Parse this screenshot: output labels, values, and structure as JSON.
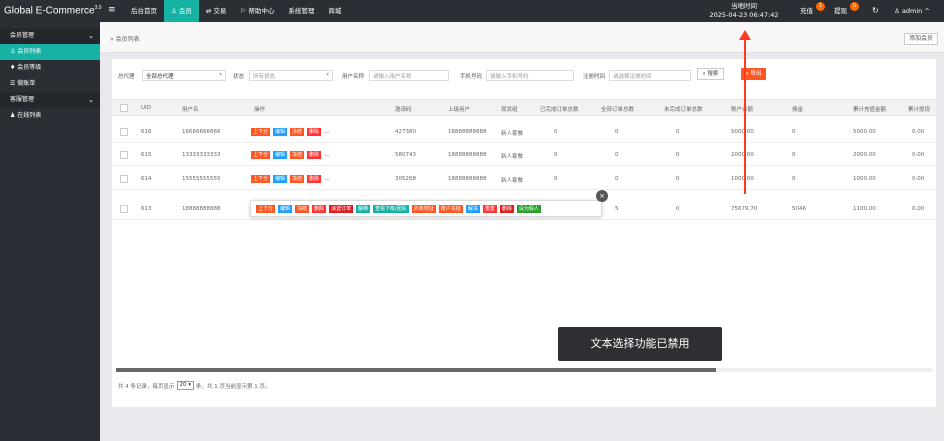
{
  "app": {
    "brand": "Global E-Commerce",
    "version": "3.0",
    "menu_toggle_icon": "≡"
  },
  "topnav": [
    {
      "label": "后台首页",
      "icon": "",
      "active": false
    },
    {
      "label": "会员",
      "icon": "person-icon",
      "active": true
    },
    {
      "label": "交易",
      "icon": "exchange-icon",
      "active": false
    },
    {
      "label": "帮助中心",
      "icon": "flag-icon",
      "active": false
    },
    {
      "label": "系统管理",
      "icon": "",
      "active": false
    },
    {
      "label": "商城",
      "icon": "",
      "active": false
    }
  ],
  "header_right": {
    "time_label": "当地时间",
    "time_value": "2025-04-23 06:47:42",
    "recharge_label": "充值",
    "recharge_count": "1",
    "withdraw_label": "提现",
    "withdraw_count": "0",
    "refresh_icon": "↻",
    "user_label": "admin"
  },
  "sidebar": {
    "groups": [
      {
        "label": "会员管理",
        "expanded": true
      },
      {
        "label": "会员列表",
        "active": true
      },
      {
        "label": "会员等级"
      },
      {
        "label": "做账单"
      },
      {
        "label": "客服管理",
        "expanded": true
      },
      {
        "label": "在线列表"
      }
    ]
  },
  "breadcrumb": {
    "separator": "»",
    "current": "会员列表",
    "add_member_label": "添加会员"
  },
  "filters": {
    "proxy_label": "总代理",
    "proxy_value": "全部总代理",
    "status_label": "状态",
    "status_value": "所有状态",
    "username_label": "用户名称",
    "username_placeholder": "请输入用户名称",
    "phone_label": "手机号码",
    "phone_placeholder": "请输入手机号码",
    "regtime_label": "注册时间",
    "regtime_placeholder": "请选择注册时间",
    "search_label": "搜索",
    "export_label": "导出"
  },
  "table": {
    "columns": [
      "UID",
      "用户名",
      "操作",
      "邀请码",
      "上级用户",
      "现状组",
      "已完成订单总数",
      "全部订单总数",
      "未完成订单总数",
      "账户余额",
      "佣金",
      "累计充值金额",
      "累计提现"
    ],
    "op_buttons": [
      {
        "label": "上下分",
        "color": "orange"
      },
      {
        "label": "编辑",
        "color": "blue"
      },
      {
        "label": "冻结",
        "color": "orange"
      },
      {
        "label": "删除",
        "color": "red"
      }
    ],
    "more": "...",
    "rows": [
      {
        "uid": "616",
        "username": "16666666666",
        "code": "427380",
        "parent": "18888888888",
        "group": "新人套餐",
        "done": "0",
        "all": "0",
        "pending": "0",
        "balance": "5000.00",
        "commission": "0",
        "recharge": "5000.00",
        "withdraw": "0.00"
      },
      {
        "uid": "615",
        "username": "13333333333",
        "code": "580743",
        "parent": "18888888888",
        "group": "新人套餐",
        "done": "0",
        "all": "0",
        "pending": "0",
        "balance": "2000.00",
        "commission": "0",
        "recharge": "2000.00",
        "withdraw": "0.00"
      },
      {
        "uid": "614",
        "username": "15555555555",
        "code": "305268",
        "parent": "18888888888",
        "group": "新人套餐",
        "done": "0",
        "all": "0",
        "pending": "0",
        "balance": "1000.00",
        "commission": "0",
        "recharge": "1000.00",
        "withdraw": "0.00"
      },
      {
        "uid": "613",
        "username": "18888888888",
        "code": "",
        "parent": "",
        "group": "",
        "done": "",
        "all": "5",
        "pending": "0",
        "balance": "75679.70",
        "commission": "5046",
        "recharge": "1100.00",
        "withdraw": "0.00"
      }
    ]
  },
  "popup": {
    "buttons": [
      {
        "label": "上下分",
        "color": "orange"
      },
      {
        "label": "编辑",
        "color": "blue"
      },
      {
        "label": "冻结",
        "color": "orange"
      },
      {
        "label": "删除",
        "color": "red"
      },
      {
        "label": "派送订单",
        "color": "darkred"
      },
      {
        "label": "解绑",
        "color": "green"
      },
      {
        "label": "查看下级/团队",
        "color": "green"
      },
      {
        "label": "外收地址",
        "color": "orange"
      },
      {
        "label": "账户冻结",
        "color": "orange"
      },
      {
        "label": "解冻",
        "color": "blue"
      },
      {
        "label": "重置",
        "color": "red"
      },
      {
        "label": "删除",
        "color": "darkred"
      },
      {
        "label": "设为假人",
        "color": "dkgreen"
      }
    ],
    "close": "×"
  },
  "pager": {
    "prefix": "共 4 条记录，每页显示",
    "page_size": "20",
    "suffix": "条，共 1 页当前显示第 1 页。"
  },
  "toast": "文本选择功能已禁用",
  "colors": {
    "topbar": "#2b2f35",
    "accent": "#16b3a5",
    "danger": "#ff5722",
    "arrow": "#ff3b1f"
  }
}
